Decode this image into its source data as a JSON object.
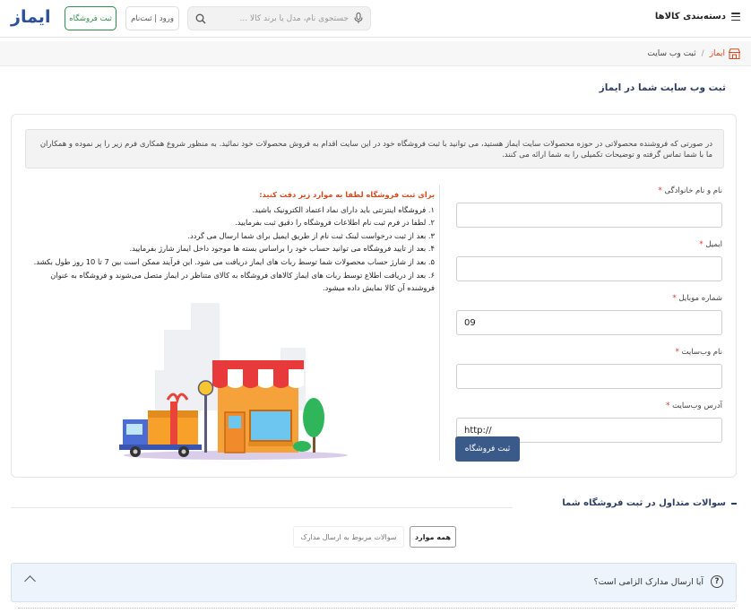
{
  "header": {
    "menu_label": "دسته‌بندی کالاها",
    "search_placeholder": "جستجوی نام، مدل یا برند کالا ...",
    "login_label": "ورود | ثبت‌نام",
    "seller_label": "ثبت فروشگاه",
    "logo_text": "ایماز"
  },
  "breadcrumb": {
    "home": "ایماز",
    "separator": "/",
    "current": "ثبت وب سایت"
  },
  "page_title": "ثبت وب سایت شما در ایماز",
  "notice": "در صورتی که فروشنده محصولاتی در حوزه محصولات سایت ایماز هستید، می توانید با ثبت فروشگاه خود در این سایت اقدام به فروش محصولات خود نمائید. به منظور شروع همکاری فرم زیر را پر نموده و همکاران ما با شما تماس گرفته و توضیحات تکمیلی را به شما ارائه می کنند.",
  "form": {
    "fields": [
      {
        "label": "نام و نام خانوادگی",
        "required": "*",
        "value": ""
      },
      {
        "label": "ایمیل",
        "required": "*",
        "value": ""
      },
      {
        "label": "شماره موبایل",
        "required": "*",
        "value": "09"
      },
      {
        "label": "نام وب‌سایت",
        "required": "*",
        "value": ""
      },
      {
        "label": "آدرس وب‌سایت",
        "required": "*",
        "value": "http://"
      }
    ],
    "submit_label": "ثبت فروشگاه"
  },
  "info": {
    "title": "برای ثبت فروشگاه لطفا به موارد زیر دقت کنید:",
    "items": [
      "۱. فروشگاه اینترنتی باید دارای نماد اعتماد الکترونیک باشید.",
      "۲. لطفا در فرم ثبت نام اطلاعات فروشگاه را دقیق ثبت بفرمایید.",
      "۳. بعد از ثبت درخواست لینک ثبت نام از طریق ایمیل برای شما ارسال می گردد.",
      "۴. بعد از تایید فروشگاه می توانید حساب خود را براساس بسته ها موجود داخل ایماز شارژ بفرمایید.",
      "۵. بعد از شارژ حساب محصولات شما توسط ربات های ایماز دریافت می شود. این فرآیند ممکن است بین 7 تا 10 روز طول بکشد.",
      "۶. بعد از دریافت اطلاع توسط ربات های ایماز کالاهای فروشگاه به کالای متناظر در ایماز متصل می‌شوند و فروشگاه به عنوان فروشنده آن کالا نمایش داده میشود."
    ]
  },
  "faq": {
    "title": "سوالات متداول در ثبت فروشگاه شما",
    "filters": {
      "all": "همه موارد",
      "docs": "سوالات مربوط به ارسال مدارک"
    },
    "question": "آیا ارسال مدارک الزامی است؟",
    "question_icon": "?"
  },
  "colors": {
    "brand_blue": "#2d4f9a",
    "brand_orange": "#f07c22",
    "seller_green": "#2f8f4e",
    "primary_button": "#3a5a8a",
    "accent_red": "#d34a1f"
  }
}
